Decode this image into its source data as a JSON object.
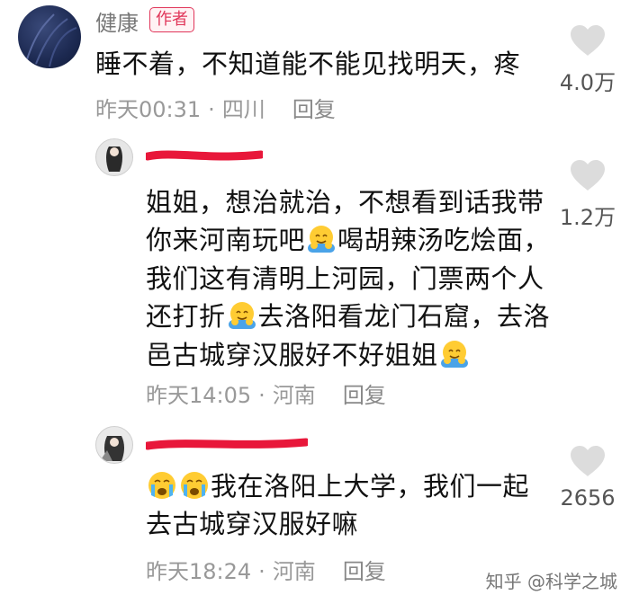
{
  "comments": [
    {
      "username": "健康",
      "badge": "作者",
      "text": "睡不着，不知道能不能见找明天，疼",
      "time": "昨天00:31",
      "location": "四川",
      "reply": "回复",
      "likes": "4.0万"
    },
    {
      "line1": "姐姐，想治就治，不想看到话我带",
      "line2a": "你来河南玩吧",
      "line2b": "喝胡辣汤吃烩面，",
      "line3": "我们这有清明上河园，门票两个人",
      "line4a": "还打折",
      "line4b": "去洛阳看龙门石窟，去洛",
      "line5": "邑古城穿汉服好不好姐姐",
      "time": "昨天14:05",
      "location": "河南",
      "reply": "回复",
      "likes": "1.2万"
    },
    {
      "line1": "我在洛阳上大学，我们一起",
      "line2": "去古城穿汉服好嘛",
      "time": "昨天18:24",
      "location": "河南",
      "reply": "回复",
      "likes": "2656"
    }
  ],
  "watermark": "知乎 @科学之城",
  "icons": {
    "like": "heart-icon",
    "hug_emoji": "hugging-face-emoji",
    "cry_emoji": "crying-face-emoji"
  },
  "colors": {
    "badge": "#e0365a",
    "redaction": "#e8173a",
    "meta": "#999999"
  }
}
